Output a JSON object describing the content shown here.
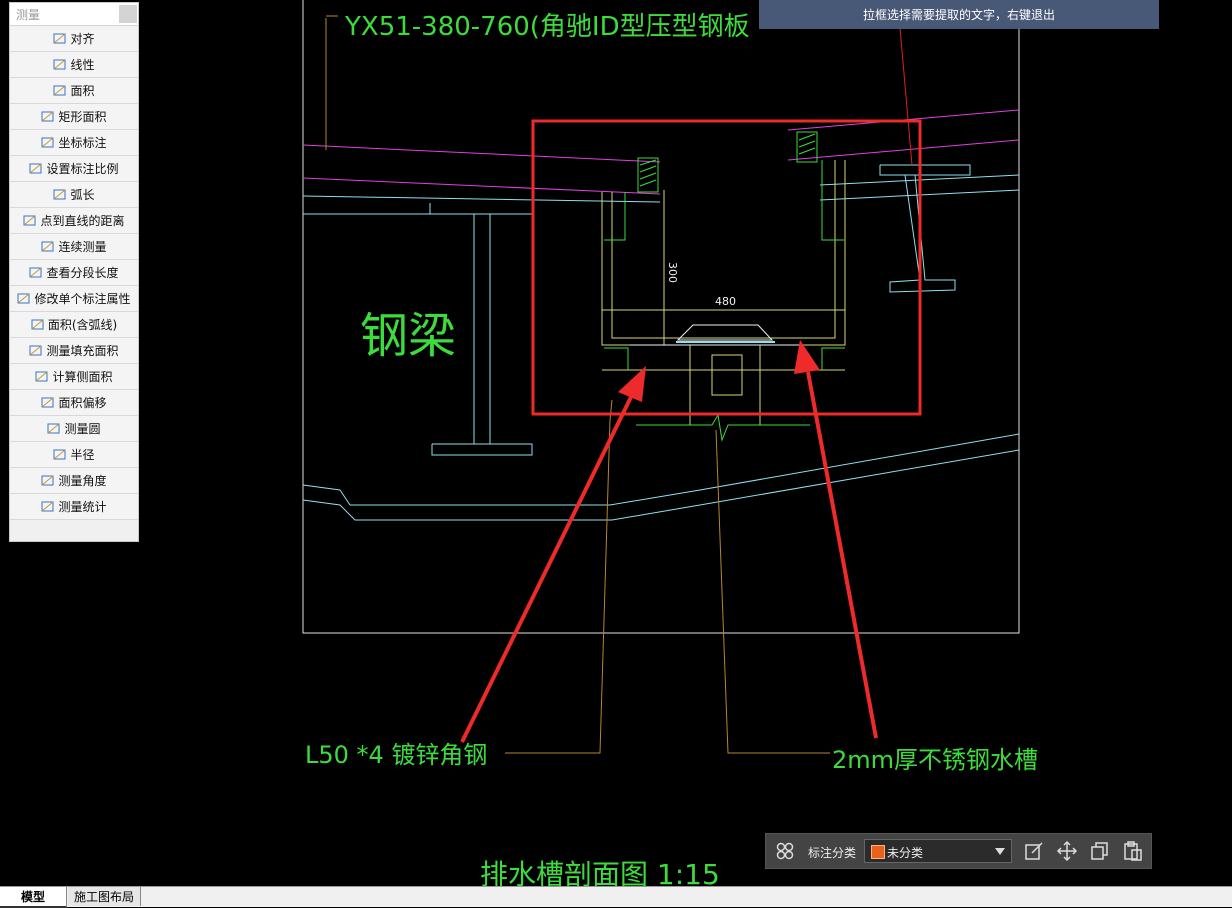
{
  "panel": {
    "title": "测量",
    "tools": [
      {
        "label": "对齐",
        "icon": "align-dimension-icon"
      },
      {
        "label": "线性",
        "icon": "linear-dimension-icon"
      },
      {
        "label": "面积",
        "icon": "area-icon"
      },
      {
        "label": "矩形面积",
        "icon": "rectangle-area-icon"
      },
      {
        "label": "坐标标注",
        "icon": "coordinate-icon"
      },
      {
        "label": "设置标注比例",
        "icon": "scale-icon"
      },
      {
        "label": "弧长",
        "icon": "arc-length-icon"
      },
      {
        "label": "点到直线的距离",
        "icon": "point-line-distance-icon"
      },
      {
        "label": "连续测量",
        "icon": "continuous-measure-icon"
      },
      {
        "label": "查看分段长度",
        "icon": "segment-length-icon"
      },
      {
        "label": "修改单个标注属性",
        "icon": "edit-dimension-icon"
      },
      {
        "label": "面积(含弧线)",
        "icon": "arc-area-icon"
      },
      {
        "label": "测量填充面积",
        "icon": "fill-area-icon"
      },
      {
        "label": "计算侧面积",
        "icon": "side-area-icon"
      },
      {
        "label": "面积偏移",
        "icon": "area-offset-icon"
      },
      {
        "label": "测量圆",
        "icon": "circle-icon"
      },
      {
        "label": "半径",
        "icon": "radius-icon"
      },
      {
        "label": "测量角度",
        "icon": "angle-icon"
      },
      {
        "label": "测量统计",
        "icon": "statistics-icon"
      }
    ]
  },
  "tip": "拉框选择需要提取的文字，右键退出",
  "drawing": {
    "top_label": "YX51-380-760(角驰ID型压型钢板",
    "beam_label": "钢梁",
    "dim_300": "300",
    "dim_480": "480",
    "left_callout": "L50 *4 镀锌角钢",
    "right_callout": "2mm厚不锈钢水槽",
    "section_title": "排水槽剖面图 1:15"
  },
  "anno_bar": {
    "label": "标注分类",
    "category": "未分类",
    "swatch_color": "#e8621e"
  },
  "tabs": {
    "model": "模型",
    "layout": "施工图布局"
  },
  "colors": {
    "cad_green": "#3ddc3d",
    "cad_cyan": "#8fe0f0",
    "cad_magenta": "#e040e0",
    "cad_yellow": "#d8d870",
    "cad_orange": "#b8862e",
    "highlight_red": "#ee2a2a"
  }
}
